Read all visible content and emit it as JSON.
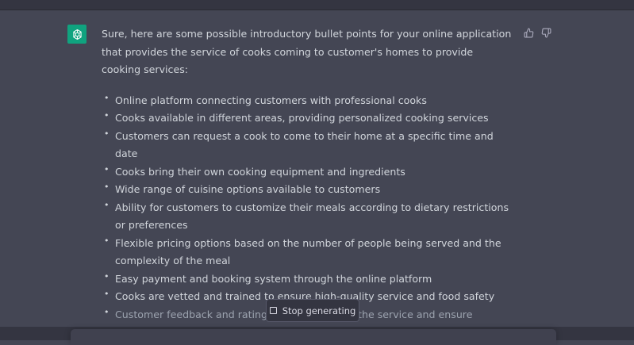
{
  "assistant": {
    "avatar_icon": "openai-logo-icon",
    "avatar_color": "#10a37f"
  },
  "message": {
    "intro": "Sure, here are some possible introductory bullet points for your online application that provides the service of cooks coming to customer's homes to provide cooking services:",
    "bullets": [
      "Online platform connecting customers with professional cooks",
      "Cooks available in different areas, providing personalized cooking services",
      "Customers can request a cook to come to their home at a specific time and date",
      "Cooks bring their own cooking equipment and ingredients",
      "Wide range of cuisine options available to customers",
      "Ability for customers to customize their meals according to dietary restrictions or preferences",
      "Flexible pricing options based on the number of people being served and the complexity of the meal",
      "Easy payment and booking system through the online platform",
      "Cooks are vetted and trained to ensure high-quality service and food safety",
      "Customer feedback and ratings to help improve the service and ensure customer satisfaction."
    ]
  },
  "feedback": {
    "thumbs_up_icon": "thumbs-up-icon",
    "thumbs_down_icon": "thumbs-down-icon"
  },
  "controls": {
    "stop_label": "Stop generating",
    "stop_icon": "stop-square-icon"
  },
  "colors": {
    "background": "#444654",
    "text": "#d1d5db",
    "accent": "#10a37f",
    "button_bg": "#343541"
  }
}
